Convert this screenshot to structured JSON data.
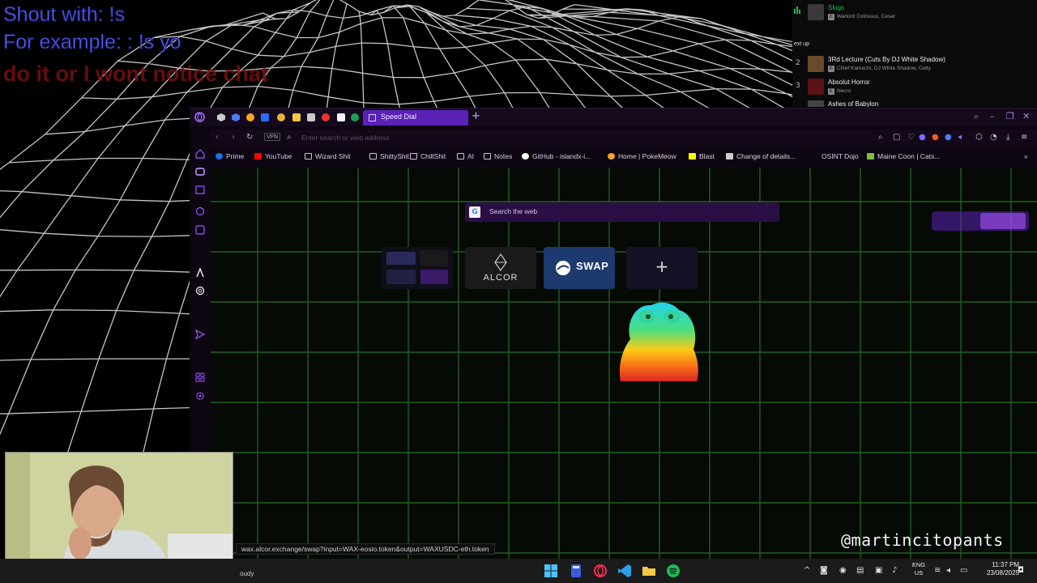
{
  "overlay": {
    "line1": "Shout with: !s",
    "line2": "For example: : !s yo",
    "line3": "do it or I wont notice chat"
  },
  "queue": {
    "next_up_label": "ext up",
    "current": {
      "title": "Slugs",
      "artists": "Warlord Colossus, Ceser"
    },
    "items": [
      {
        "num": "2",
        "title": "3Rd Lecture (Cuts By DJ White Shadow)",
        "artists": "Chief Kamachi, DJ White Shadow, Cetty"
      },
      {
        "num": "3",
        "title": "Absolut Horror",
        "artists": "Necro"
      },
      {
        "num": "",
        "title": "Ashes of Babylon",
        "artists": ""
      }
    ]
  },
  "browser": {
    "active_tab_label": "Speed Dial",
    "new_tab_symbol": "+",
    "vpn_label": "VPN",
    "address_placeholder": "Enter search or web address",
    "bookmarks": [
      {
        "label": "Prime",
        "icon": "prime-icon",
        "color": "#1a73e8"
      },
      {
        "label": "YouTube",
        "icon": "youtube-icon",
        "color": "#ff0000"
      },
      {
        "label": "Wizard Shit",
        "icon": "folder-icon",
        "color": ""
      },
      {
        "label": "ShittyShit",
        "icon": "folder-icon",
        "color": ""
      },
      {
        "label": "ChillShit",
        "icon": "folder-icon",
        "color": ""
      },
      {
        "label": "AI",
        "icon": "folder-icon",
        "color": ""
      },
      {
        "label": "Notes",
        "icon": "folder-icon",
        "color": ""
      },
      {
        "label": "GitHub - islandx-i...",
        "icon": "github-icon",
        "color": "#ffffff"
      },
      {
        "label": "Home | PokeMeow",
        "icon": "pokemeow-icon",
        "color": "#f5a623"
      },
      {
        "label": "Blast",
        "icon": "blast-icon",
        "color": "#fcfc03"
      },
      {
        "label": "Change of details...",
        "icon": "page-icon",
        "color": "#cccccc"
      },
      {
        "label": "OSINT Dojo",
        "icon": "",
        "color": ""
      },
      {
        "label": "Maine Coon | Cats...",
        "icon": "maine-coon-icon",
        "color": "#7cc142"
      }
    ],
    "search_label": "Search the web",
    "search_engine_letter": "G",
    "speed_dial": [
      {
        "name": "tile-wallets",
        "label": ""
      },
      {
        "name": "tile-alcor",
        "label": "ALCOR"
      },
      {
        "name": "tile-swap",
        "label": "SWAP"
      },
      {
        "name": "tile-add",
        "label": "+"
      }
    ],
    "status_url": "wax.alcor.exchange/swap?input=WAX-eosio.token&output=WAXUSDC-eth.token"
  },
  "watermark": "@martincitopants",
  "taskbar": {
    "weather": "oudy",
    "lang_line1": "ENG",
    "lang_line2": "US",
    "time": "11:37 PM",
    "date": "23/08/2025"
  }
}
